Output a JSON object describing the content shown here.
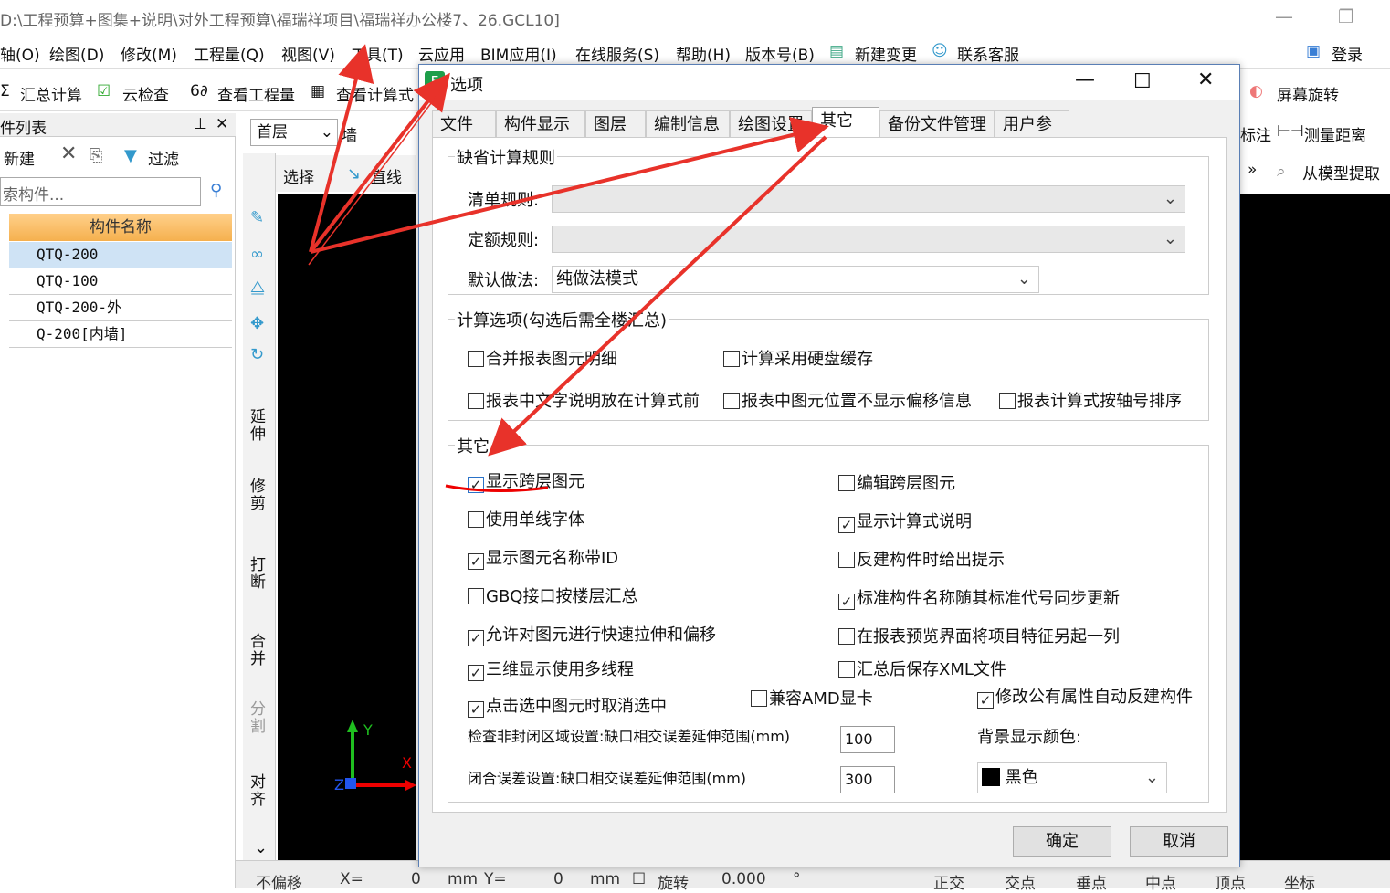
{
  "app": {
    "title": "D:\\工程预算+图集+说明\\对外工程预算\\福瑞祥项目\\福瑞祥办公楼7、26.GCL10]"
  },
  "menu": [
    "轴(O)",
    "绘图(D)",
    "修改(M)",
    "工程量(Q)",
    "视图(V)",
    "工具(T)",
    "云应用",
    "BIM应用(I)",
    "在线服务(S)",
    "帮助(H)",
    "版本号(B)",
    "新建变更",
    "联系客服",
    "登录"
  ],
  "toolbar": {
    "sum": "汇总计算",
    "cloud_check": "云检查",
    "view_qty": "查看工程量",
    "view_formula": "查看计算式",
    "screen_rotate": "屏幕旋转",
    "mark": "标注",
    "measure": "测量距离",
    "extract": "从模型提取"
  },
  "left": {
    "title": "件列表",
    "new": "新建",
    "filter": "过滤",
    "search_placeholder": "索构件...",
    "col_header": "构件名称",
    "rows": [
      "QTQ-200",
      "QTQ-100",
      "QTQ-200-外",
      "Q-200[内墙]"
    ]
  },
  "floor": {
    "value": "首层",
    "type": "墙"
  },
  "draw": {
    "select": "选择",
    "line": "直线"
  },
  "vtools": [
    "延伸",
    "修剪",
    "打断",
    "合并",
    "分割",
    "对齐"
  ],
  "axes": {
    "y": "Y",
    "x": "X",
    "z": "Z"
  },
  "status": {
    "offset": "不偏移",
    "x_label": "X=",
    "x_val": "0",
    "mm": "mm",
    "y_label": "Y=",
    "y_val": "0",
    "mm2": "mm",
    "rotate": "旋转",
    "angle": "0.000",
    "deg": "°",
    "ortho": "正交",
    "intersect": "交点",
    "perp": "垂点",
    "mid": "中点",
    "vertex": "顶点",
    "coord": "坐标"
  },
  "dialog": {
    "title": "选项",
    "tabs": [
      "文件",
      "构件显示",
      "图层",
      "编制信息",
      "绘图设置",
      "其它",
      "备份文件管理",
      "用户参与"
    ],
    "group1": {
      "title": "缺省计算规则",
      "bill_label": "清单规则:",
      "quota_label": "定额规则:",
      "method_label": "默认做法:",
      "method_value": "纯做法模式"
    },
    "group2": {
      "title": "计算选项(勾选后需全楼汇总)",
      "opts": [
        "合并报表图元明细",
        "计算采用硬盘缓存",
        "报表中文字说明放在计算式前",
        "报表中图元位置不显示偏移信息",
        "报表计算式按轴号排序"
      ]
    },
    "group3": {
      "title": "其它",
      "left": [
        {
          "t": "显示跨层图元",
          "c": true
        },
        {
          "t": "使用单线字体",
          "c": false
        },
        {
          "t": "显示图元名称带ID",
          "c": true
        },
        {
          "t": "GBQ接口按楼层汇总",
          "c": false
        },
        {
          "t": "允许对图元进行快速拉伸和偏移",
          "c": true
        },
        {
          "t": "三维显示使用多线程",
          "c": true
        },
        {
          "t": "点击选中图元时取消选中",
          "c": true
        }
      ],
      "right": [
        {
          "t": "编辑跨层图元",
          "c": false
        },
        {
          "t": "显示计算式说明",
          "c": true
        },
        {
          "t": "反建构件时给出提示",
          "c": false
        },
        {
          "t": "标准构件名称随其标准代号同步更新",
          "c": true
        },
        {
          "t": "在报表预览界面将项目特征另起一列",
          "c": false
        },
        {
          "t": "汇总后保存XML文件",
          "c": false
        }
      ],
      "amd": {
        "t": "兼容AMD显卡",
        "c": false
      },
      "auto_rebuild": {
        "t": "修改公有属性自动反建构件",
        "c": true
      },
      "check_label": "检查非封闭区域设置:缺口相交误差延伸范围(mm)",
      "check_val": "100",
      "close_label": "闭合误差设置:缺口相交误差延伸范围(mm)",
      "close_val": "300",
      "bg_label": "背景显示颜色:",
      "bg_value": "黑色"
    },
    "ok": "确定",
    "cancel": "取消"
  },
  "colors": {
    "annotation": "#e8322a",
    "underline": "#e00",
    "canvas": "#000000"
  }
}
